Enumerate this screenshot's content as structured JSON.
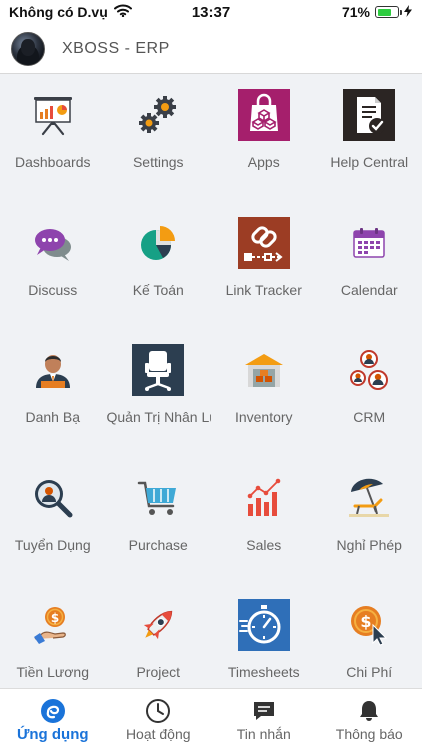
{
  "status_bar": {
    "carrier": "Không có D.vụ",
    "time": "13:37",
    "battery_text": "71%",
    "battery_level": 0.71,
    "wifi_icon": "wifi-icon",
    "charging_icon": "charging-bolt-icon"
  },
  "header": {
    "title": "XBOSS - ERP",
    "avatar_icon": "user-avatar"
  },
  "apps": [
    {
      "label": "Dashboards",
      "icon": "presentation-board-icon"
    },
    {
      "label": "Settings",
      "icon": "gears-icon"
    },
    {
      "label": "Apps",
      "icon": "shopping-bag-cubes-icon"
    },
    {
      "label": "Help Central",
      "icon": "document-check-icon"
    },
    {
      "label": "Discuss",
      "icon": "chat-bubbles-icon"
    },
    {
      "label": "Kế Toán",
      "icon": "pie-chart-icon"
    },
    {
      "label": "Link Tracker",
      "icon": "link-chain-icon"
    },
    {
      "label": "Calendar",
      "icon": "calendar-icon"
    },
    {
      "label": "Danh Bạ",
      "icon": "contact-person-icon"
    },
    {
      "label": "Quản Trị Nhân Lự",
      "icon": "office-chair-icon"
    },
    {
      "label": "Inventory",
      "icon": "warehouse-icon"
    },
    {
      "label": "CRM",
      "icon": "people-network-icon"
    },
    {
      "label": "Tuyển Dụng",
      "icon": "magnifier-person-icon"
    },
    {
      "label": "Purchase",
      "icon": "shopping-cart-icon"
    },
    {
      "label": "Sales",
      "icon": "bar-chart-trend-icon"
    },
    {
      "label": "Nghỉ Phép",
      "icon": "beach-umbrella-icon"
    },
    {
      "label": "Tiền Lương",
      "icon": "hand-coin-icon"
    },
    {
      "label": "Project",
      "icon": "rocket-icon"
    },
    {
      "label": "Timesheets",
      "icon": "stopwatch-icon"
    },
    {
      "label": "Chi Phí",
      "icon": "coin-cursor-icon"
    }
  ],
  "tabs": [
    {
      "label": "Ứng dụng",
      "icon": "apps-logo-icon",
      "active": true
    },
    {
      "label": "Hoạt động",
      "icon": "clock-icon",
      "active": false
    },
    {
      "label": "Tin nhắn",
      "icon": "message-icon",
      "active": false
    },
    {
      "label": "Thông báo",
      "icon": "bell-icon",
      "active": false
    }
  ],
  "colors": {
    "accent": "#1a73d9",
    "grid_background": "#f0f2f5"
  }
}
